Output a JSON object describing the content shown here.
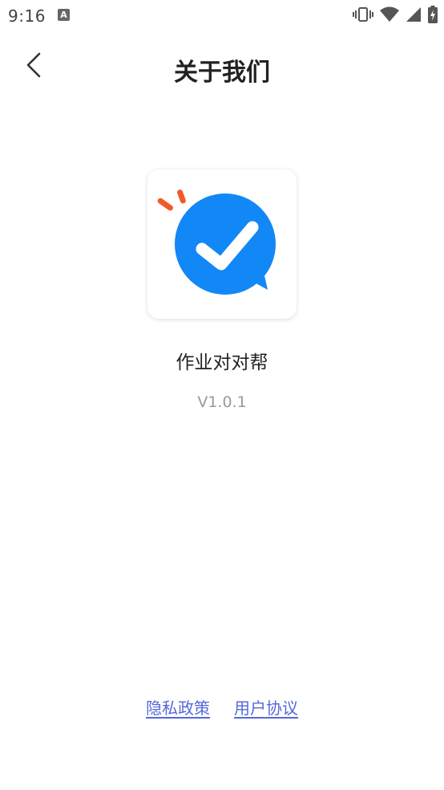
{
  "status_bar": {
    "time": "9:16",
    "app_badge": "A",
    "icons": [
      "vibrate-icon",
      "wifi-icon",
      "signal-icon",
      "battery-charging-icon"
    ]
  },
  "header": {
    "back_icon": "chevron-left-icon",
    "title": "关于我们"
  },
  "app": {
    "logo_icon": "check-bubble-logo-icon",
    "name": "作业对对帮",
    "version": "V1.0.1"
  },
  "footer": {
    "privacy_label": "隐私政策",
    "agreement_label": "用户协议"
  },
  "colors": {
    "logo_blue": "#1288f7",
    "logo_orange": "#f25a2a",
    "link": "#5668d8",
    "title": "#222222",
    "version": "#9a9a9a"
  }
}
